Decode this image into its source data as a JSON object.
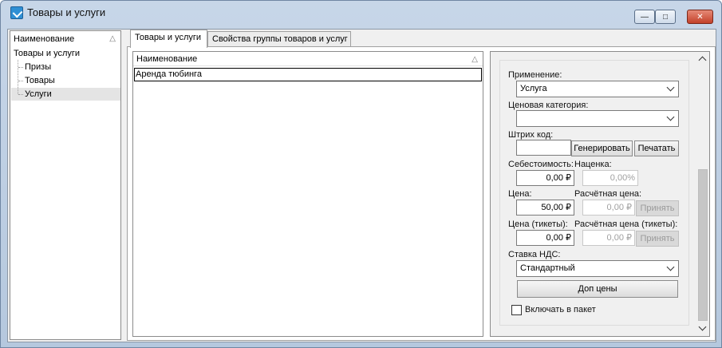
{
  "window": {
    "title": "Товары и услуги",
    "min_symbol": "—",
    "max_symbol": "□",
    "close_symbol": "✕"
  },
  "tree": {
    "header": "Наименование",
    "sort_glyph": "△",
    "items": [
      {
        "label": "Товары и услуги"
      },
      {
        "label": "Призы"
      },
      {
        "label": "Товары"
      },
      {
        "label": "Услуги"
      }
    ]
  },
  "tabs": [
    {
      "label": "Товары и услуги",
      "active": true
    },
    {
      "label": "Свойства группы товаров и услуг",
      "active": false
    }
  ],
  "list": {
    "header": "Наименование",
    "sort_glyph": "△",
    "rows": [
      {
        "label": "Аренда тюбинга"
      }
    ]
  },
  "props": {
    "usage_label": "Применение:",
    "usage_value": "Услуга",
    "price_category_label": "Ценовая категория:",
    "price_category_value": "",
    "barcode_label": "Штрих код:",
    "barcode_value": "",
    "generate_button": "Генерировать",
    "print_button": "Печатать",
    "cost_label": "Себестоимость:",
    "markup_label": "Наценка:",
    "cost_value": "0,00 ₽",
    "markup_value": "0,00%",
    "price_label": "Цена:",
    "calc_price_label": "Расчётная цена:",
    "price_value": "50,00 ₽",
    "calc_price_value": "0,00 ₽",
    "accept_button": "Принять",
    "price_tickets_label": "Цена (тикеты):",
    "calc_price_tickets_label": "Расчётная цена (тикеты):",
    "price_tickets_value": "0,00 ₽",
    "calc_price_tickets_value": "0,00 ₽",
    "accept_tickets_button": "Принять",
    "vat_label": "Ставка НДС:",
    "vat_value": "Стандартный",
    "extra_prices_button": "Доп цены",
    "include_in_package_label": "Включать в пакет",
    "include_in_package_checked": false
  }
}
